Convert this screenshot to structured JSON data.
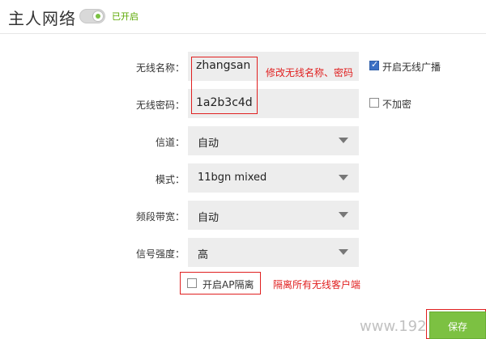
{
  "header": {
    "title": "主人网络",
    "toggle_status": "已开启"
  },
  "form": {
    "ssid": {
      "label": "无线名称：",
      "value": "zhangsan",
      "annotation": "修改无线名称、密码"
    },
    "broadcast": {
      "label": "开启无线广播",
      "checked": true
    },
    "password": {
      "label": "无线密码：",
      "value": "1a2b3c4d"
    },
    "no_encrypt": {
      "label": "不加密",
      "checked": false
    },
    "channel": {
      "label": "信道：",
      "value": "自动"
    },
    "mode": {
      "label": "模式：",
      "value": "11bgn mixed"
    },
    "bandwidth": {
      "label": "频段带宽：",
      "value": "自动"
    },
    "signal": {
      "label": "信号强度：",
      "value": "高"
    },
    "ap_isolation": {
      "label": "开启AP隔离",
      "checked": false,
      "annotation": "隔离所有无线客户端"
    }
  },
  "footer": {
    "save_label": "保存",
    "watermark": "www.192"
  },
  "colors": {
    "accent": "#7cc142",
    "annotation": "#e02020",
    "field_bg": "#ededed"
  },
  "icons": {
    "select_arrow": "triangle-down-icon",
    "toggle": "toggle-switch-icon"
  }
}
